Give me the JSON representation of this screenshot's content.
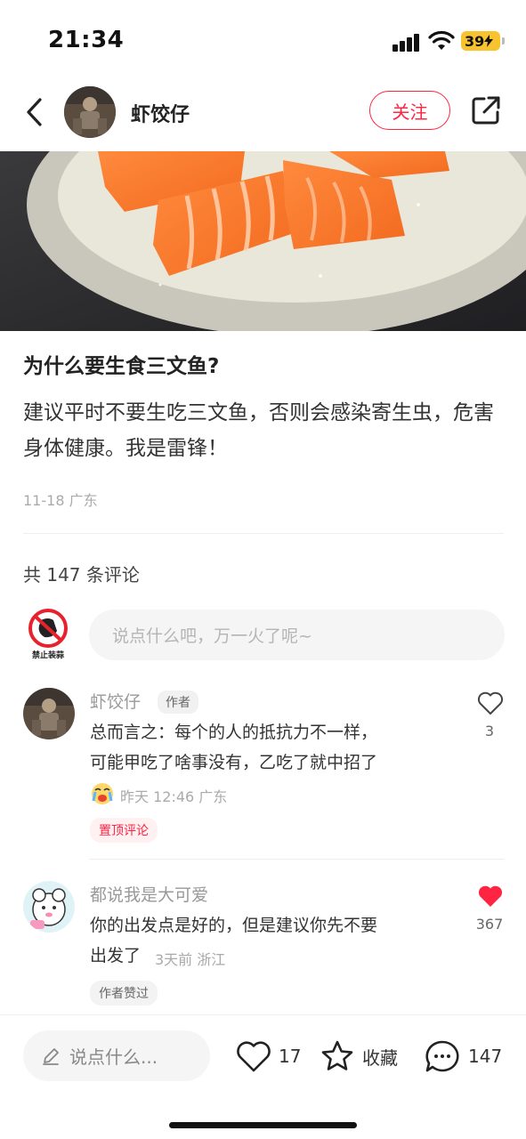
{
  "status_bar": {
    "time": "21:34",
    "battery": "39"
  },
  "header": {
    "author": "虾饺仔",
    "follow_label": "关注"
  },
  "post": {
    "title": "为什么要生食三文鱼?",
    "body": "建议平时不要生吃三文鱼，否则会感染寄生虫，危害身体健康。我是雷锋！",
    "meta": "11-18 广东"
  },
  "comments_section": {
    "count_label": "共 147 条评论",
    "input_placeholder": "说点什么吧，万一火了呢~",
    "my_avatar_label": "禁止装蒜"
  },
  "comments": [
    {
      "name": "虾饺仔",
      "tag": "作者",
      "text_lines": [
        "总而言之：每个的人的抵抗力不一样，",
        "可能甲吃了啥事没有，乙吃了就中招了"
      ],
      "meta": "昨天 12:46 广东",
      "badge": "置顶评论",
      "likes": "3",
      "liked": false
    },
    {
      "name": "都说我是大可爱",
      "text_lines": [
        "你的出发点是好的，但是建议你先不要",
        "出发了"
      ],
      "meta": "3天前 浙江",
      "badge": "作者赞过",
      "likes": "367",
      "liked": true
    }
  ],
  "bottom_bar": {
    "input_placeholder": "说点什么...",
    "like_count": "17",
    "collect_label": "收藏",
    "comment_count": "147"
  },
  "colors": {
    "accent": "#ff2442",
    "battery": "#f7c32e"
  }
}
